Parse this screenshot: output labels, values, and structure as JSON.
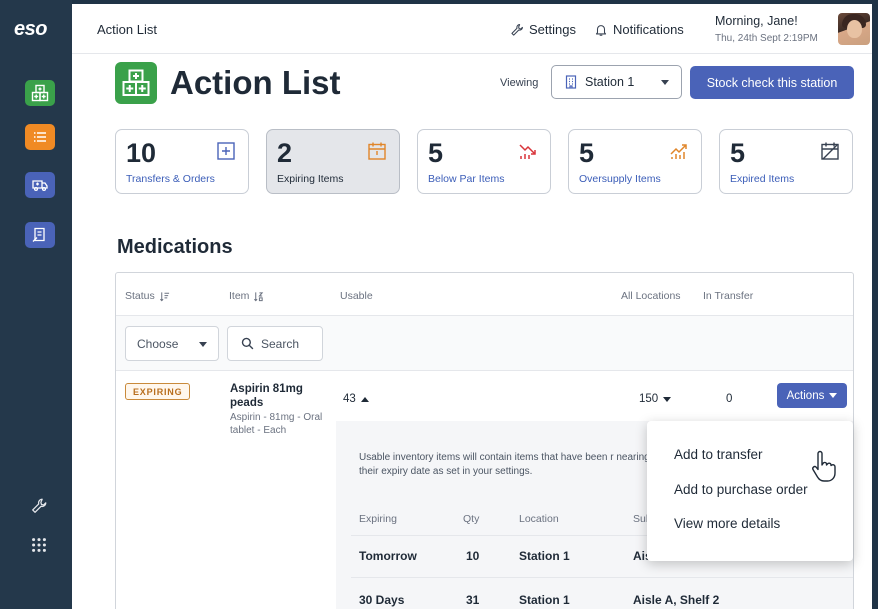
{
  "app": {
    "logo": "eso"
  },
  "topbar": {
    "breadcrumb": "Action List",
    "settings_label": "Settings",
    "notifications_label": "Notifications",
    "greeting": "Morning, Jane!",
    "datetime": "Thu, 24th Sept 2:19PM"
  },
  "page": {
    "title": "Action List",
    "viewing_label": "Viewing",
    "station_selected": "Station 1",
    "stock_check_label": "Stock check this station"
  },
  "summary_cards": [
    {
      "count": "10",
      "label": "Transfers & Orders",
      "icon": "plus-square-icon"
    },
    {
      "count": "2",
      "label": "Expiring Items",
      "icon": "calendar-icon"
    },
    {
      "count": "5",
      "label": "Below Par Items",
      "icon": "trend-down-icon"
    },
    {
      "count": "5",
      "label": "Oversupply Items",
      "icon": "trend-up-icon"
    },
    {
      "count": "5",
      "label": "Expired Items",
      "icon": "calendar-x-icon"
    }
  ],
  "medications": {
    "title": "Medications",
    "columns": {
      "status": "Status",
      "item": "Item",
      "usable": "Usable",
      "all_locations": "All Locations",
      "in_transfer": "In Transfer"
    },
    "filter": {
      "choose": "Choose",
      "search_placeholder": "Search"
    },
    "row": {
      "status": "EXPIRING",
      "name": "Aspirin 81mg peads",
      "description": "Aspirin - 81mg - Oral tablet - Each",
      "usable": "43",
      "all_locations": "150",
      "in_transfer": "0",
      "actions_label": "Actions"
    },
    "detail": {
      "note": "Usable inventory items will contain items that have been r nearing their expiry date as set in your settings.",
      "headers": {
        "expiring": "Expiring",
        "qty": "Qty",
        "location": "Location",
        "sub": "Sub"
      },
      "rows": [
        {
          "expiring": "Tomorrow",
          "qty": "10",
          "location": "Station 1",
          "sub": "Ais"
        },
        {
          "expiring": "30 Days",
          "qty": "31",
          "location": "Station 1",
          "sub": "Aisle A, Shelf 2"
        }
      ]
    }
  },
  "actions_menu": [
    "Add to transfer",
    "Add to purchase order",
    "View more details"
  ],
  "colors": {
    "sidebar": "#24384b",
    "primary": "#4a63b8",
    "green": "#3aa14a",
    "orange": "#f08a24",
    "expiring": "#b86e1d"
  }
}
